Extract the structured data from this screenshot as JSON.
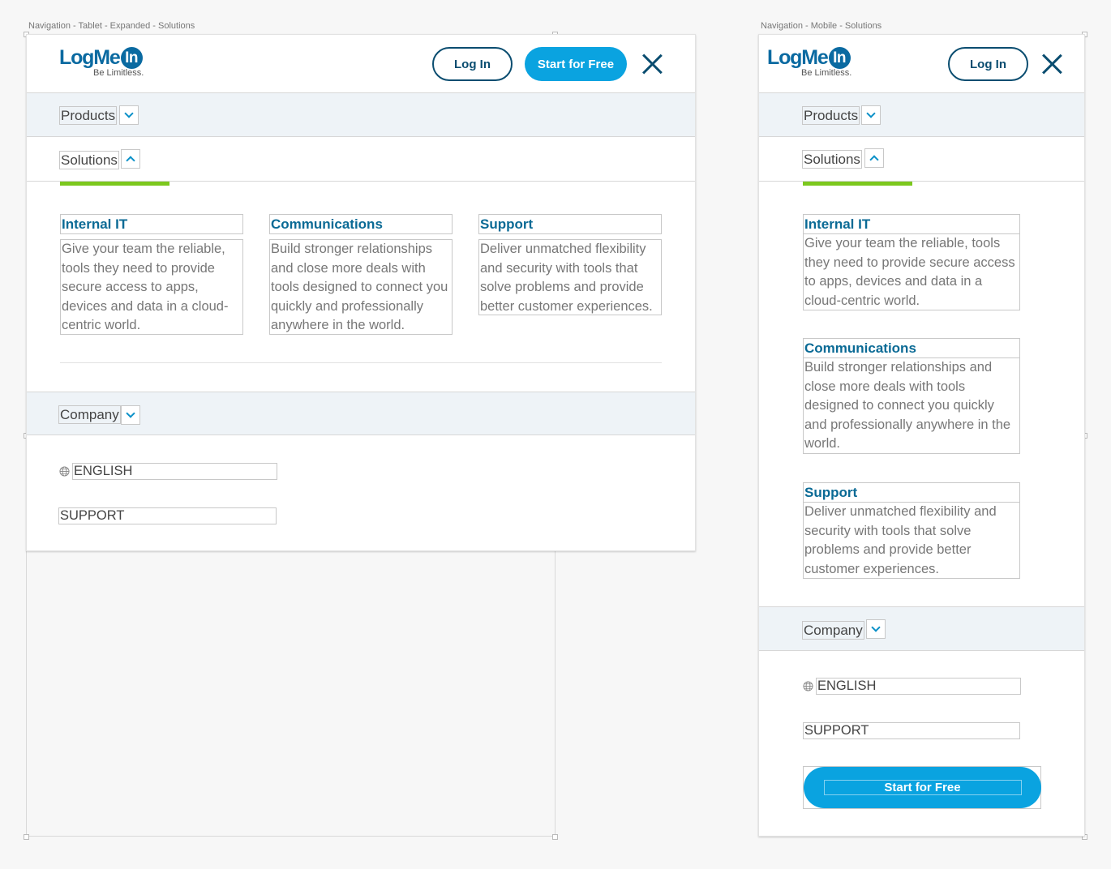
{
  "artboards": {
    "tablet_label": "Navigation - Tablet - Expanded - Solutions",
    "mobile_label": "Navigation - Mobile - Solutions"
  },
  "brand": {
    "logo_text": "LogMe",
    "logo_badge": "In",
    "tagline": "Be Limitless.",
    "primary_color": "#0aa3e0",
    "dark_color": "#0a4d70",
    "accent_color": "#7cc81e"
  },
  "header": {
    "login_label": "Log In",
    "start_label": "Start for Free",
    "close_icon": "close-icon"
  },
  "nav": {
    "products_label": "Products",
    "solutions_label": "Solutions",
    "company_label": "Company"
  },
  "solutions": [
    {
      "title": "Internal IT",
      "description": "Give your team the reliable, tools they need to provide secure access to apps, devices and data in a cloud-centric world."
    },
    {
      "title": "Communications",
      "description": "Build stronger relationships and close more deals with tools designed to connect you quickly and professionally anywhere in the world."
    },
    {
      "title": "Support",
      "description": "Deliver unmatched flexibility and security with tools that solve problems and provide better customer experiences."
    }
  ],
  "utility": {
    "language_label": "ENGLISH",
    "support_label": "SUPPORT",
    "language_icon": "globe-icon"
  },
  "mobile_cta": {
    "label": "Start for Free"
  }
}
